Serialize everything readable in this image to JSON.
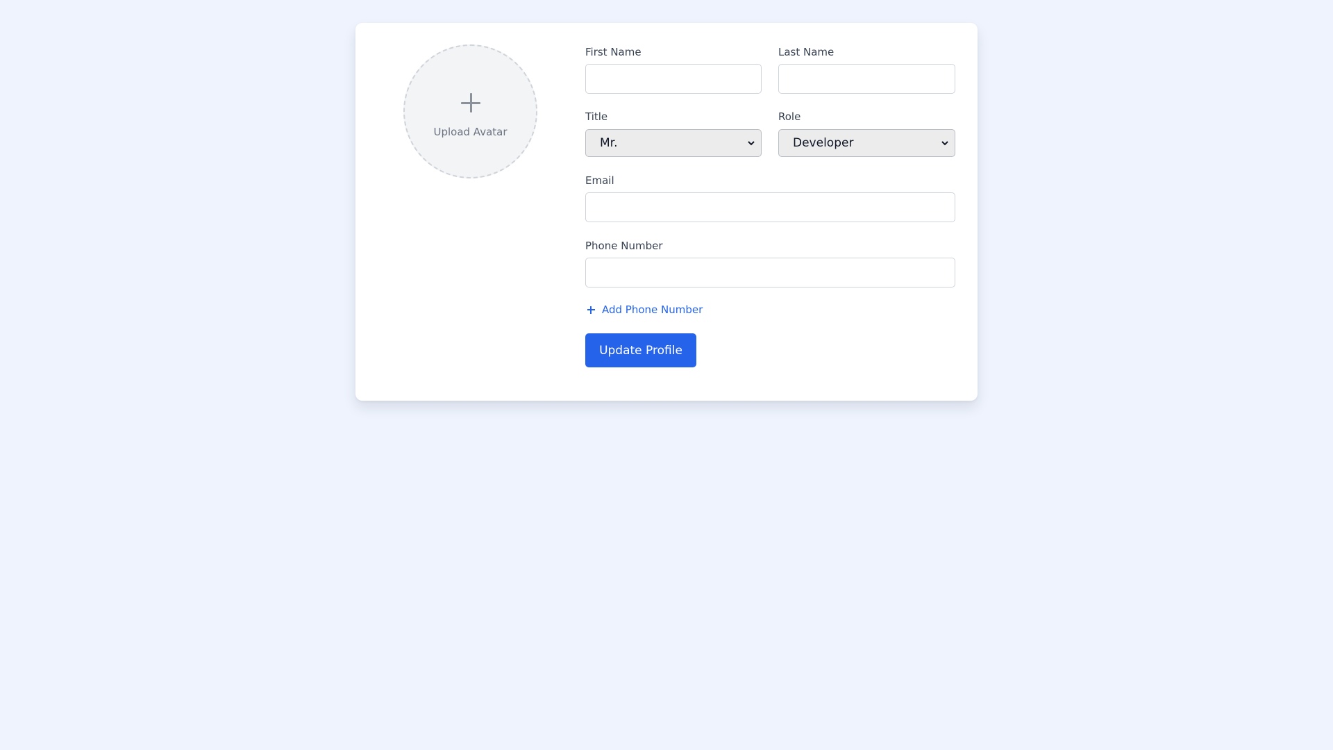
{
  "avatar": {
    "label": "Upload Avatar",
    "icon": "plus-icon"
  },
  "form": {
    "first_name": {
      "label": "First Name",
      "value": "",
      "placeholder": ""
    },
    "last_name": {
      "label": "Last Name",
      "value": "",
      "placeholder": ""
    },
    "title": {
      "label": "Title",
      "selected": "Mr."
    },
    "role": {
      "label": "Role",
      "selected": "Developer"
    },
    "email": {
      "label": "Email",
      "value": "",
      "placeholder": ""
    },
    "phone": {
      "label": "Phone Number",
      "value": "",
      "placeholder": ""
    },
    "add_phone_label": "Add Phone Number",
    "submit_label": "Update Profile"
  },
  "colors": {
    "page_background": "#eef3fd",
    "card_background": "#ffffff",
    "accent": "#2563eb",
    "avatar_background": "#f3f4f6",
    "select_background": "#ececec"
  }
}
